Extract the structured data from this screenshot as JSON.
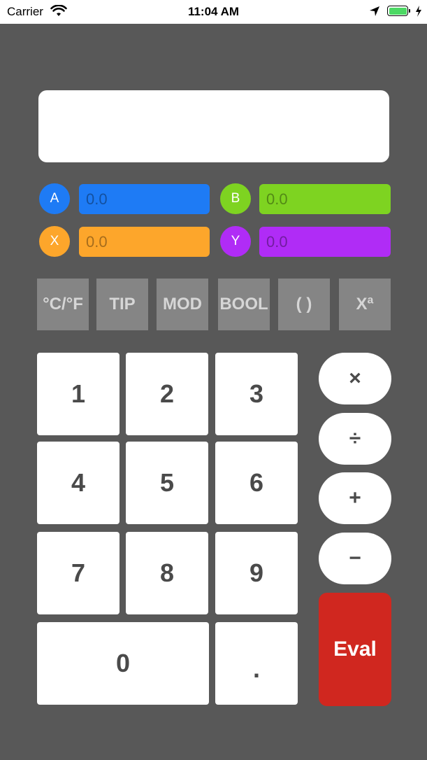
{
  "status_bar": {
    "carrier": "Carrier",
    "time": "11:04 AM"
  },
  "variables": [
    {
      "name": "A",
      "placeholder": "0.0",
      "color": "#1e7bf5"
    },
    {
      "name": "B",
      "placeholder": "0.0",
      "color": "#7ed321"
    },
    {
      "name": "X",
      "placeholder": "0.0",
      "color": "#fda62b"
    },
    {
      "name": "Y",
      "placeholder": "0.0",
      "color": "#b02cf6"
    }
  ],
  "function_buttons": [
    "°C/°F",
    "TIP",
    "MOD",
    "BOOL",
    "( )",
    "Xª"
  ],
  "digits": [
    "1",
    "2",
    "3",
    "4",
    "5",
    "6",
    "7",
    "8",
    "9",
    "0",
    "."
  ],
  "operators": [
    "×",
    "÷",
    "+",
    "−"
  ],
  "eval_label": "Eval",
  "colors": {
    "background": "#585858",
    "eval": "#d0271f",
    "function_button": "#858585"
  }
}
